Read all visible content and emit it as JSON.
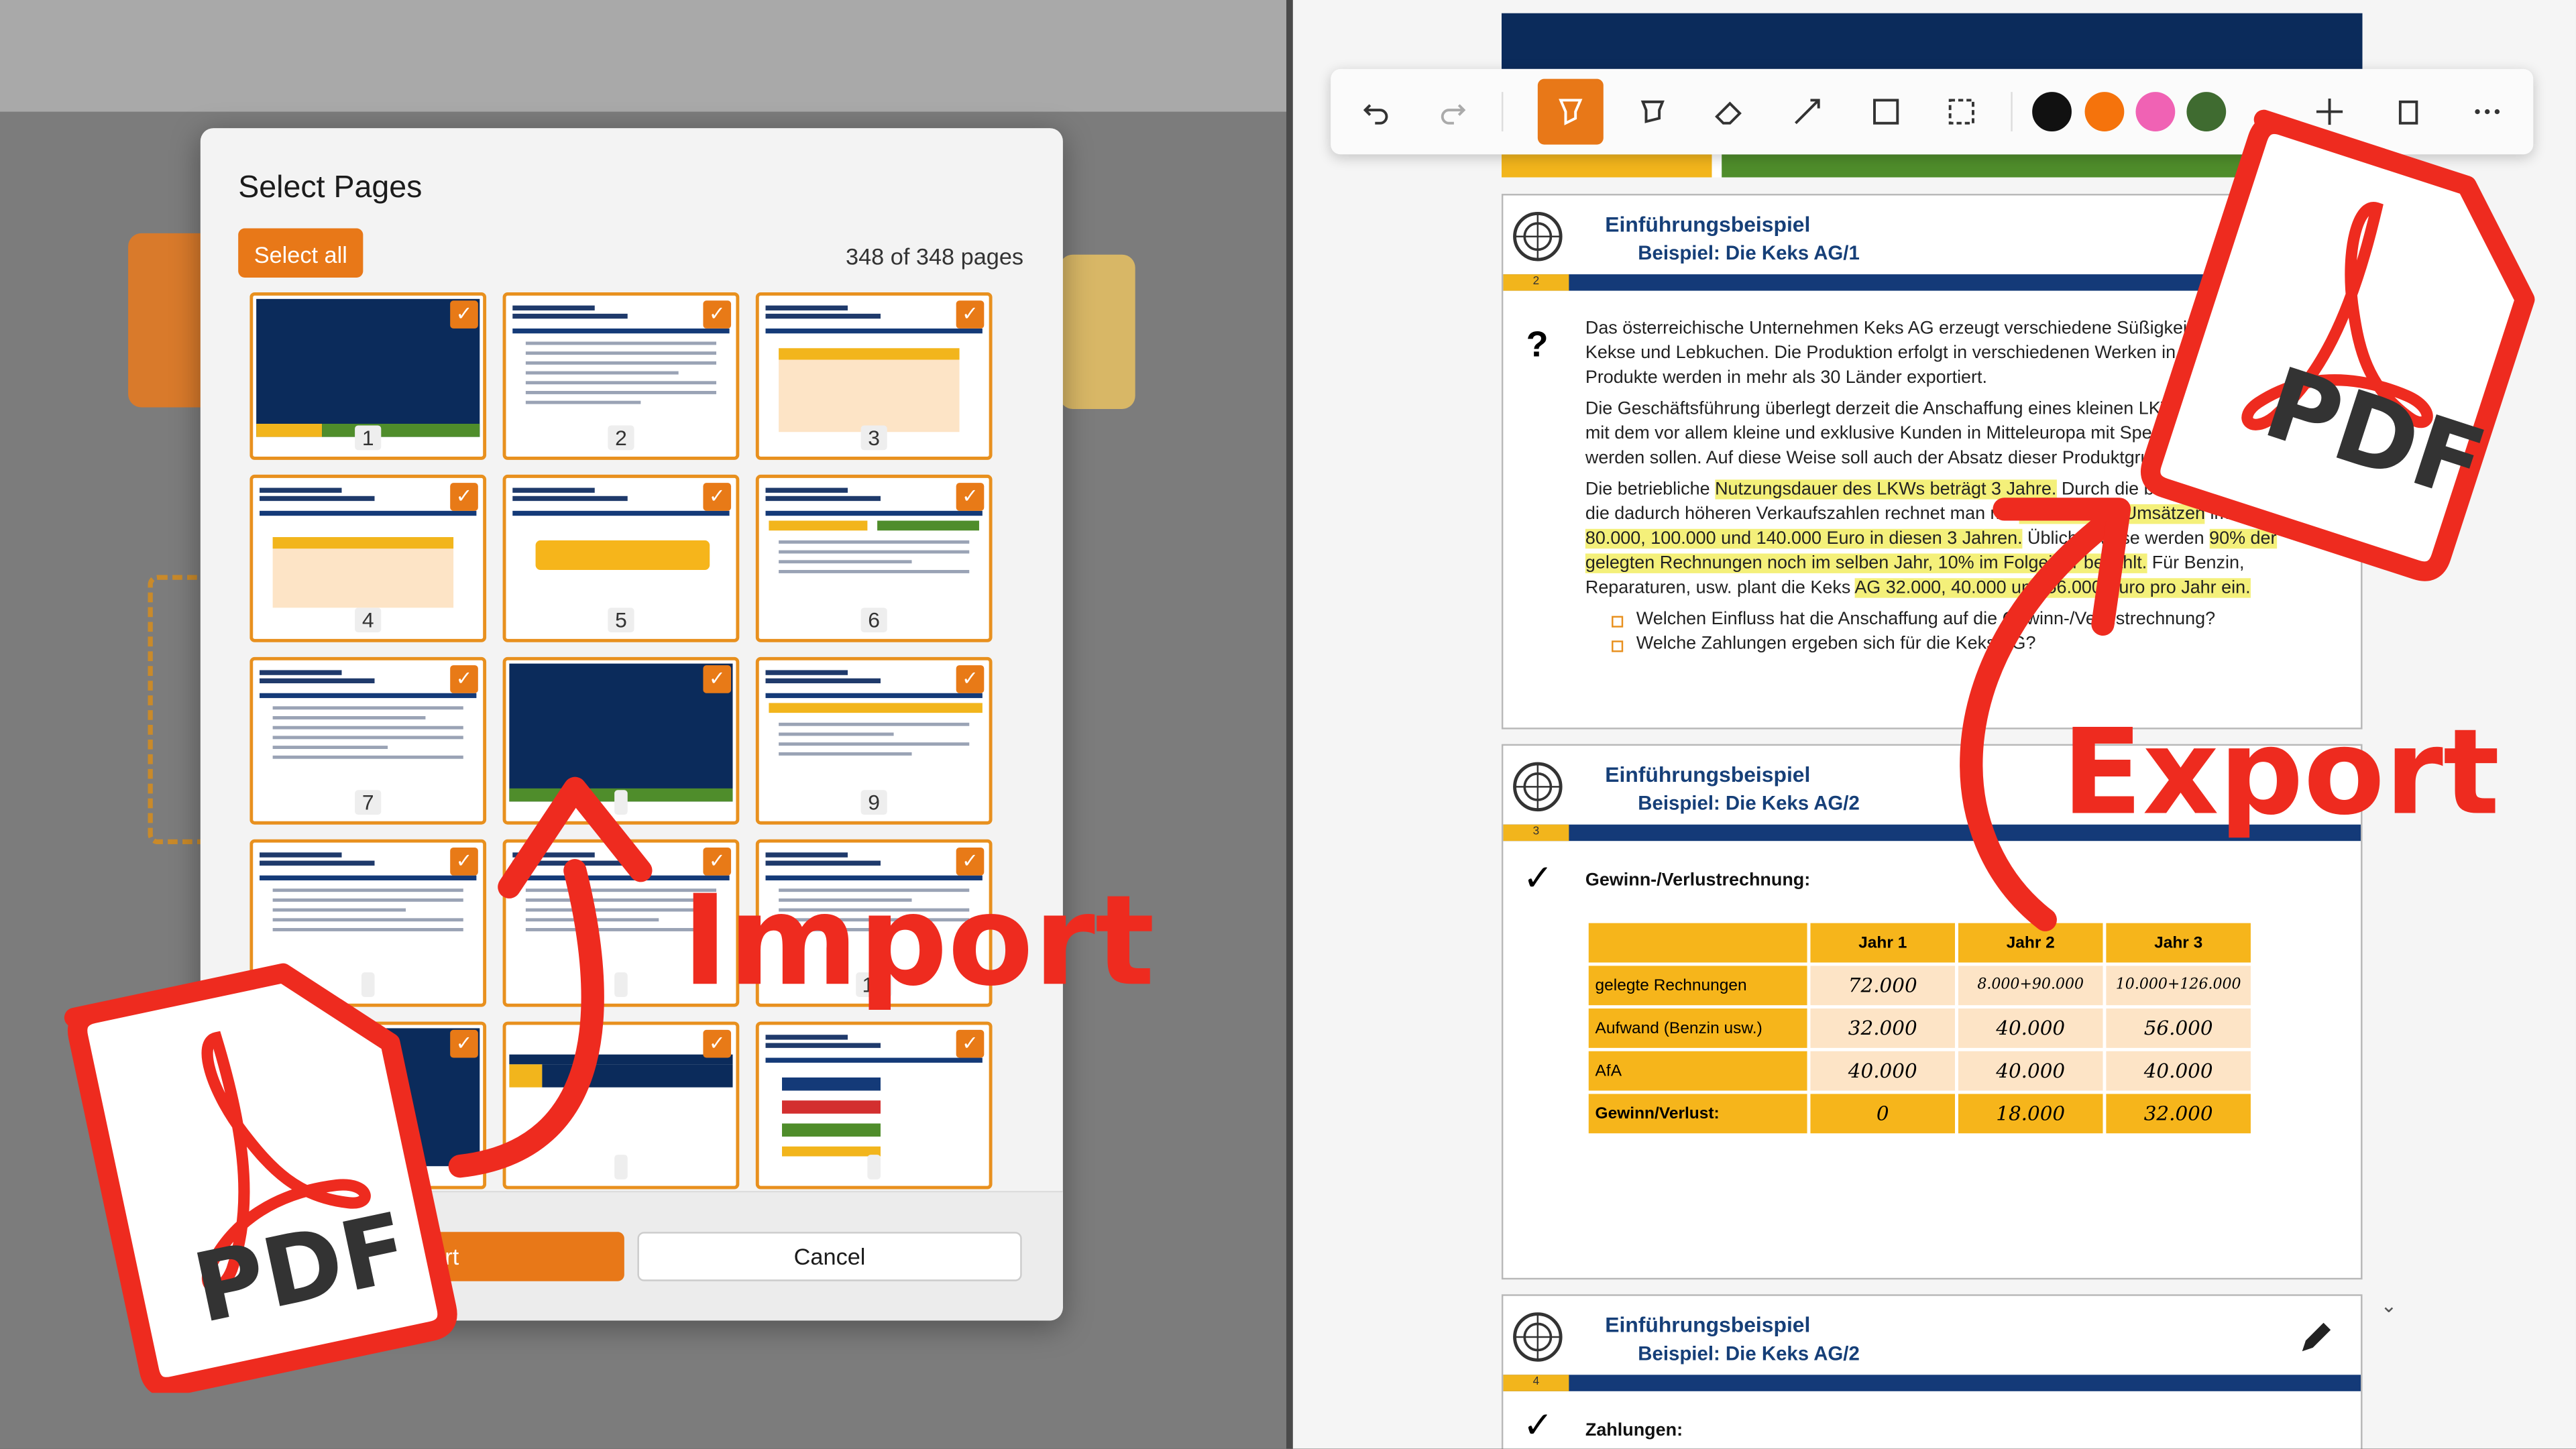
{
  "dialog": {
    "title": "Select Pages",
    "select_all_label": "Select all",
    "page_count": "348 of 348 pages",
    "import_label": "Import",
    "cancel_label": "Cancel",
    "thumbnails": [
      "1",
      "2",
      "3",
      "4",
      "5",
      "6",
      "7",
      "",
      "9",
      "",
      "",
      "12",
      "",
      "",
      ""
    ]
  },
  "overlay": {
    "import_text": "Import",
    "export_text": "Export",
    "pdf_text": "PDF"
  },
  "toolbar": {
    "colors": [
      "#111111",
      "#f5730c",
      "#f062b4",
      "#3f6b30"
    ]
  },
  "pages": [
    {
      "number": "2",
      "title": "Einführungsbeispiel",
      "subtitle": "Beispiel: Die Keks AG/1",
      "marker": "?",
      "para1": "Das österreichische Unternehmen Keks AG erzeugt verschiedene Süßigkeiten wie Waffeln, Kekse und Lebkuchen. Die Produktion erfolgt in verschiedenen Werken in Österreich, die Produkte werden in mehr als 30 Länder exportiert.",
      "para2": "Die Geschäftsführung überlegt derzeit die Anschaffung eines kleinen LKWs um 120.000 Euro, mit dem vor allem kleine und exklusive Kunden in Mitteleuropa mit Spezialprodukten beliefert werden sollen. Auf diese Weise soll auch der Absatz dieser Produktgruppe gesteigert werden.",
      "para3_a": "Die betriebliche ",
      "para3_hl1": "Nutzungsdauer des LKWs beträgt 3 Jahre.",
      "para3_b": " Durch die bessere Belieferung und die dadurch höheren Verkaufszahlen rechnet man mit ",
      "para3_hl2": "zusätzlichen Umsätzen",
      "para3_c": " im Wert von ",
      "para3_hl3": "80.000, 100.000 und 140.000 Euro in diesen 3 Jahren.",
      "para3_d": " Üblicherweise werden ",
      "para3_hl4": "90% der gelegten Rechnungen noch im selben Jahr, 10% im Folgejahr bezahlt.",
      "para3_e": " Für Benzin, Reparaturen, usw. plant die Keks ",
      "para3_hl5": "AG 32.000, 40.000 und 56.000 Euro pro Jahr ein.",
      "q1": "Welchen Einfluss hat die Anschaffung auf die Gewinn-/Verlustrechnung?",
      "q2": "Welche Zahlungen ergeben sich für die Keks AG?"
    },
    {
      "number": "3",
      "title": "Einführungsbeispiel",
      "subtitle": "Beispiel: Die Keks AG/2",
      "marker": "✓",
      "section": "Gewinn-/Verlustrechnung:",
      "columns": [
        "",
        "Jahr 1",
        "Jahr 2",
        "Jahr 3"
      ],
      "rows": [
        {
          "label": "gelegte Rechnungen",
          "values": [
            "72.000",
            "8.000+90.000",
            "10.000+126.000"
          ]
        },
        {
          "label": "Aufwand (Benzin usw.)",
          "values": [
            "32.000",
            "40.000",
            "56.000"
          ]
        },
        {
          "label": "AfA",
          "values": [
            "40.000",
            "40.000",
            "40.000"
          ]
        },
        {
          "label": "Gewinn/Verlust:",
          "values": [
            "0",
            "18.000",
            "32.000"
          ]
        }
      ]
    },
    {
      "number": "4",
      "title": "Einführungsbeispiel",
      "subtitle": "Beispiel: Die Keks AG/2",
      "marker": "✓",
      "section": "Zahlungen:"
    }
  ]
}
